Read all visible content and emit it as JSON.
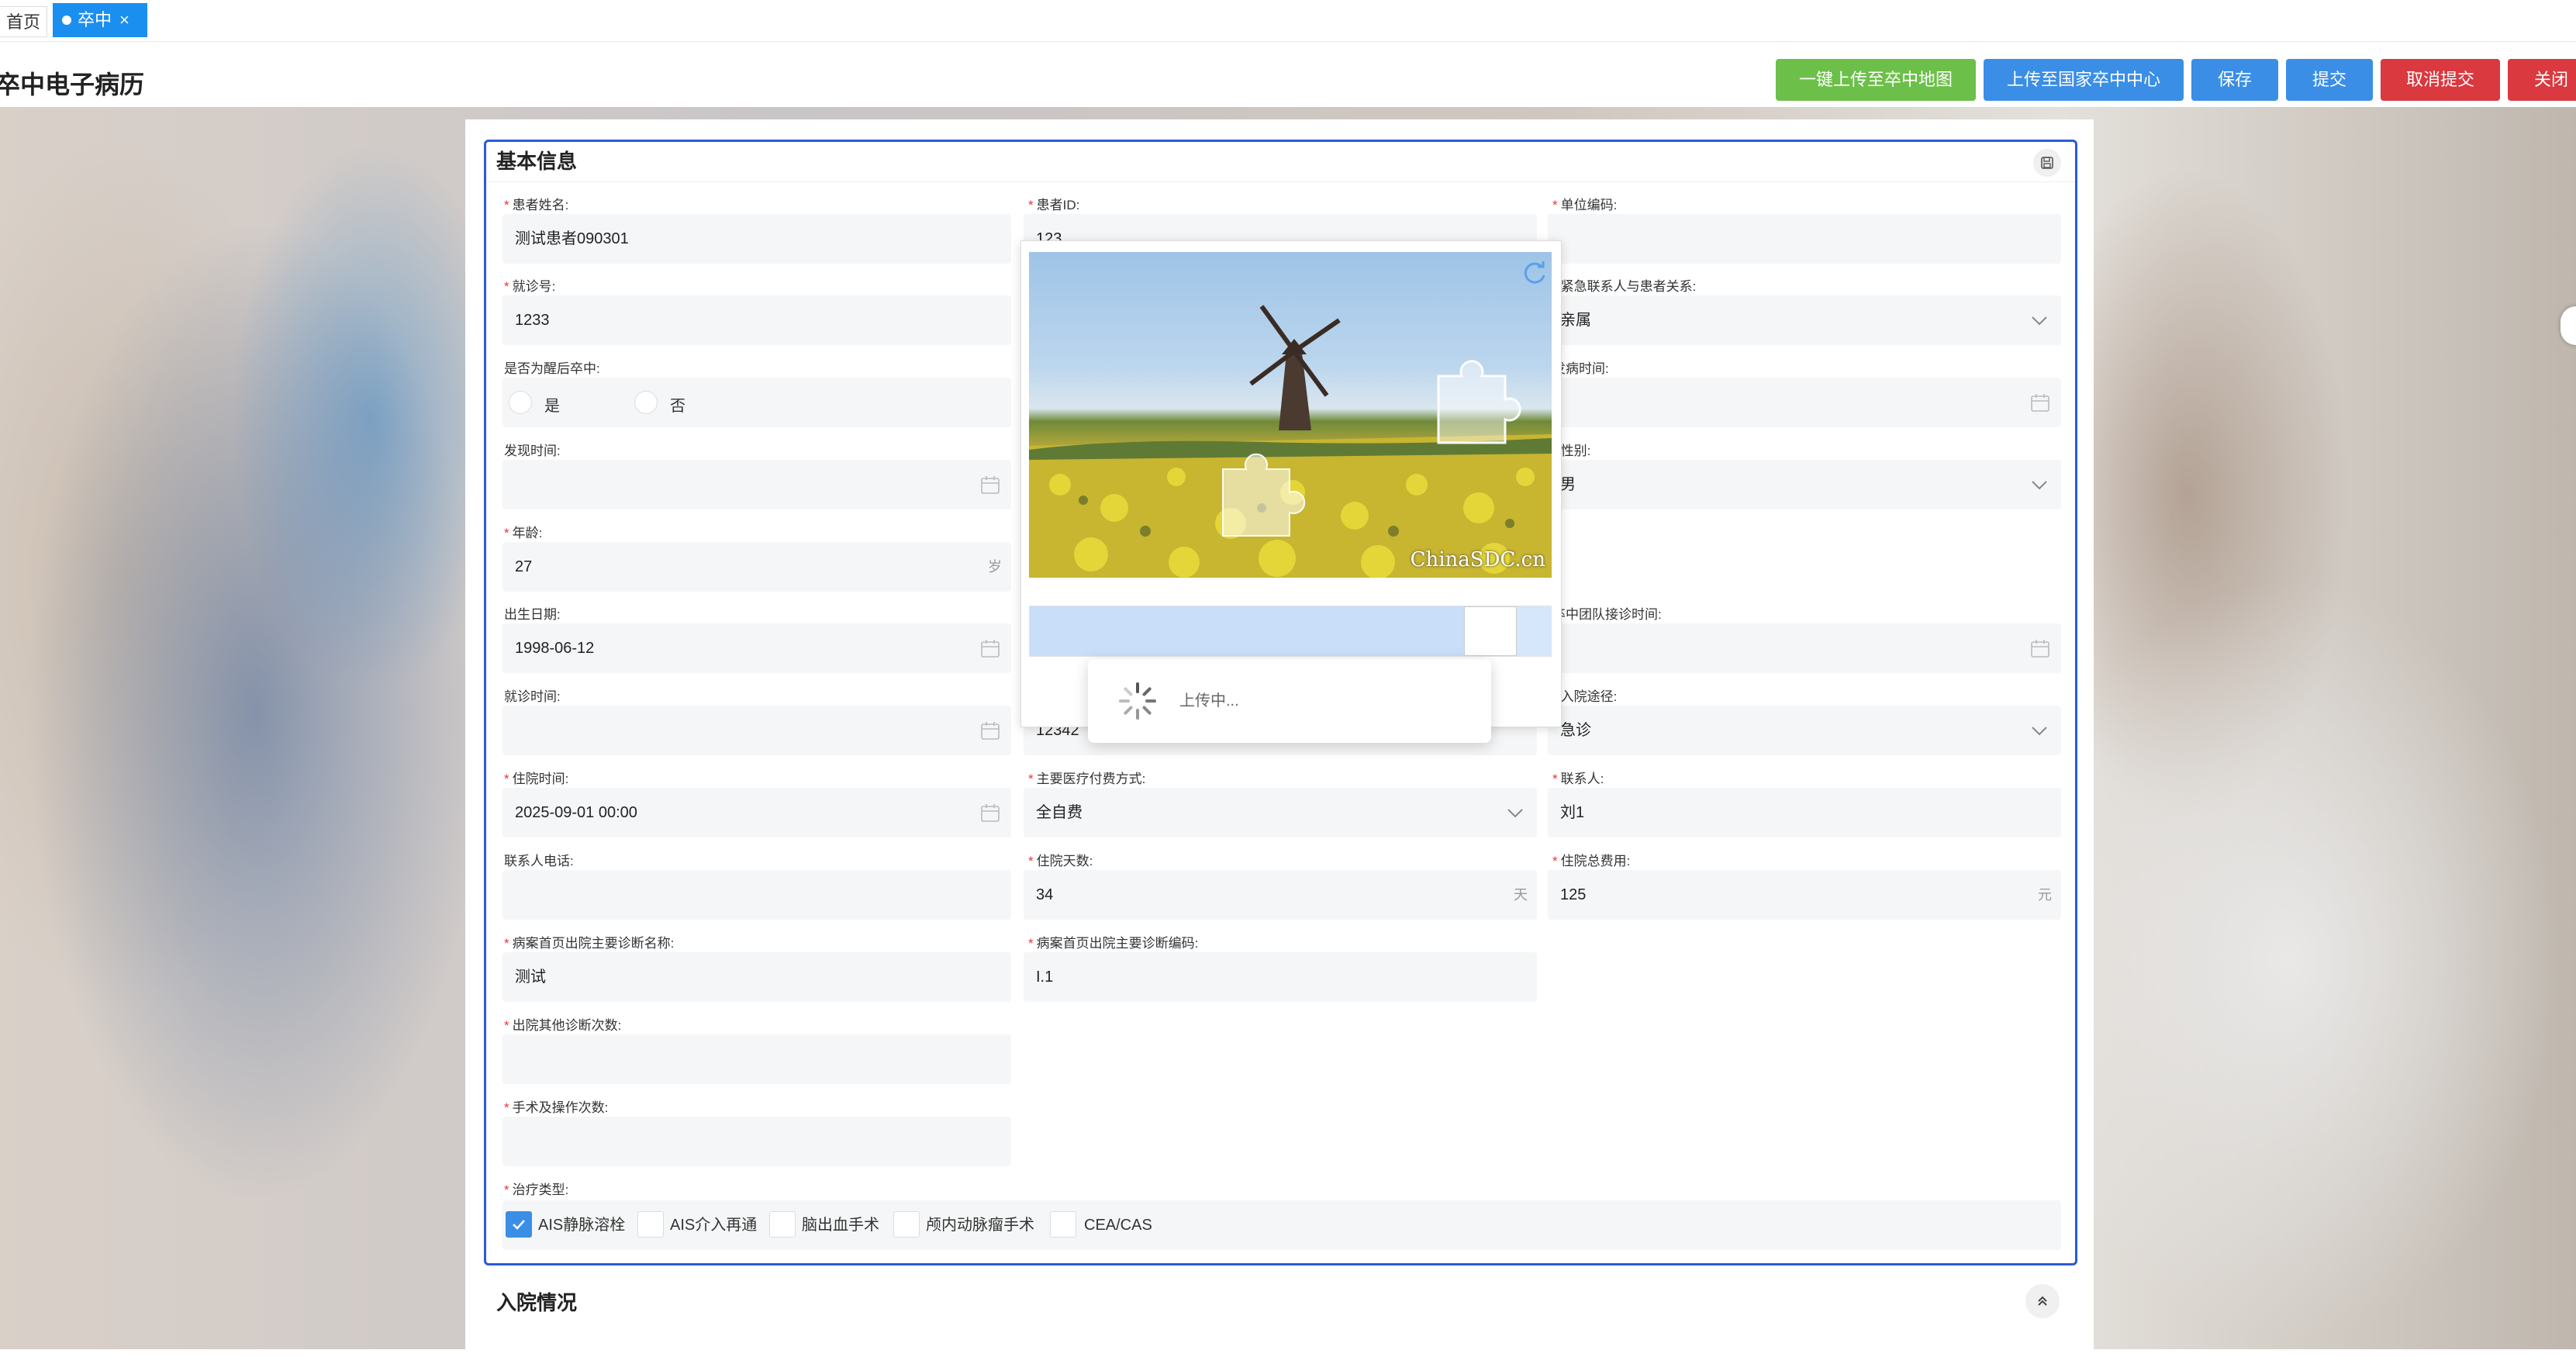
{
  "tabs": {
    "home": "首页",
    "active": "卒中",
    "close": "×"
  },
  "page": {
    "title": "卒中电子病历"
  },
  "toolbar": {
    "buttons": [
      {
        "label": "一键上传至卒中地图",
        "color": "#6cc04a"
      },
      {
        "label": "上传至国家卒中中心",
        "color": "#3a8ee6"
      },
      {
        "label": "保存",
        "color": "#3a8ee6"
      },
      {
        "label": "提交",
        "color": "#3a8ee6"
      },
      {
        "label": "取消提交",
        "color": "#d9393f"
      },
      {
        "label": "关闭",
        "color": "#d9393f"
      }
    ]
  },
  "basic": {
    "title": "基本信息",
    "fields": {
      "name": {
        "label": "患者姓名:",
        "value": "测试患者090301"
      },
      "patient_id": {
        "label": "患者ID:",
        "value": "123"
      },
      "unit_code": {
        "label": "单位编码:",
        "value": ""
      },
      "visit_no": {
        "label": "就诊号:",
        "value": "1233"
      },
      "relation": {
        "label": "紧急联系人与患者关系:",
        "value": "亲属"
      },
      "wake_stroke": {
        "label": "是否为醒后卒中:",
        "yes": "是",
        "no": "否"
      },
      "onset_time": {
        "label": "发病时间:",
        "value": ""
      },
      "discover_time": {
        "label": "发现时间:",
        "value": ""
      },
      "gender": {
        "label": "性别:",
        "value": "男"
      },
      "age": {
        "label": "年龄:",
        "value": "27",
        "unit": "岁"
      },
      "birth": {
        "label": "出生日期:",
        "value": "1998-06-12"
      },
      "team_time": {
        "label": "卒中团队接诊时间:",
        "value": ""
      },
      "visit_time": {
        "label": "就诊时间:",
        "value": ""
      },
      "admit_route": {
        "label": "入院途径:",
        "value": "急诊"
      },
      "hidden_value": "12342",
      "admit_time": {
        "label": "住院时间:",
        "value": "2025-09-01 00:00"
      },
      "pay_method": {
        "label": "主要医疗付费方式:",
        "value": "全自费"
      },
      "contact": {
        "label": "联系人:",
        "value": "刘1"
      },
      "contact_phone": {
        "label": "联系人电话:",
        "value": ""
      },
      "stay_days": {
        "label": "住院天数:",
        "value": "34",
        "unit": "天"
      },
      "total_cost": {
        "label": "住院总费用:",
        "value": "125",
        "unit": "元"
      },
      "diag_name": {
        "label": "病案首页出院主要诊断名称:",
        "value": "测试"
      },
      "diag_code": {
        "label": "病案首页出院主要诊断编码:",
        "value": "I.1"
      },
      "other_diag": {
        "label": "出院其他诊断次数:",
        "value": ""
      },
      "surgery_count": {
        "label": "手术及操作次数:",
        "value": ""
      },
      "treatment": {
        "label": "治疗类型:",
        "options": [
          {
            "label": "AIS静脉溶栓",
            "checked": true
          },
          {
            "label": "AIS介入再通",
            "checked": false
          },
          {
            "label": "脑出血手术",
            "checked": false
          },
          {
            "label": "颅内动脉瘤手术",
            "checked": false
          },
          {
            "label": "CEA/CAS",
            "checked": false
          }
        ]
      }
    }
  },
  "admission": {
    "title": "入院情况"
  },
  "captcha": {
    "watermark": "ChinaSDC.cn"
  },
  "loading": {
    "text": "上传中..."
  }
}
